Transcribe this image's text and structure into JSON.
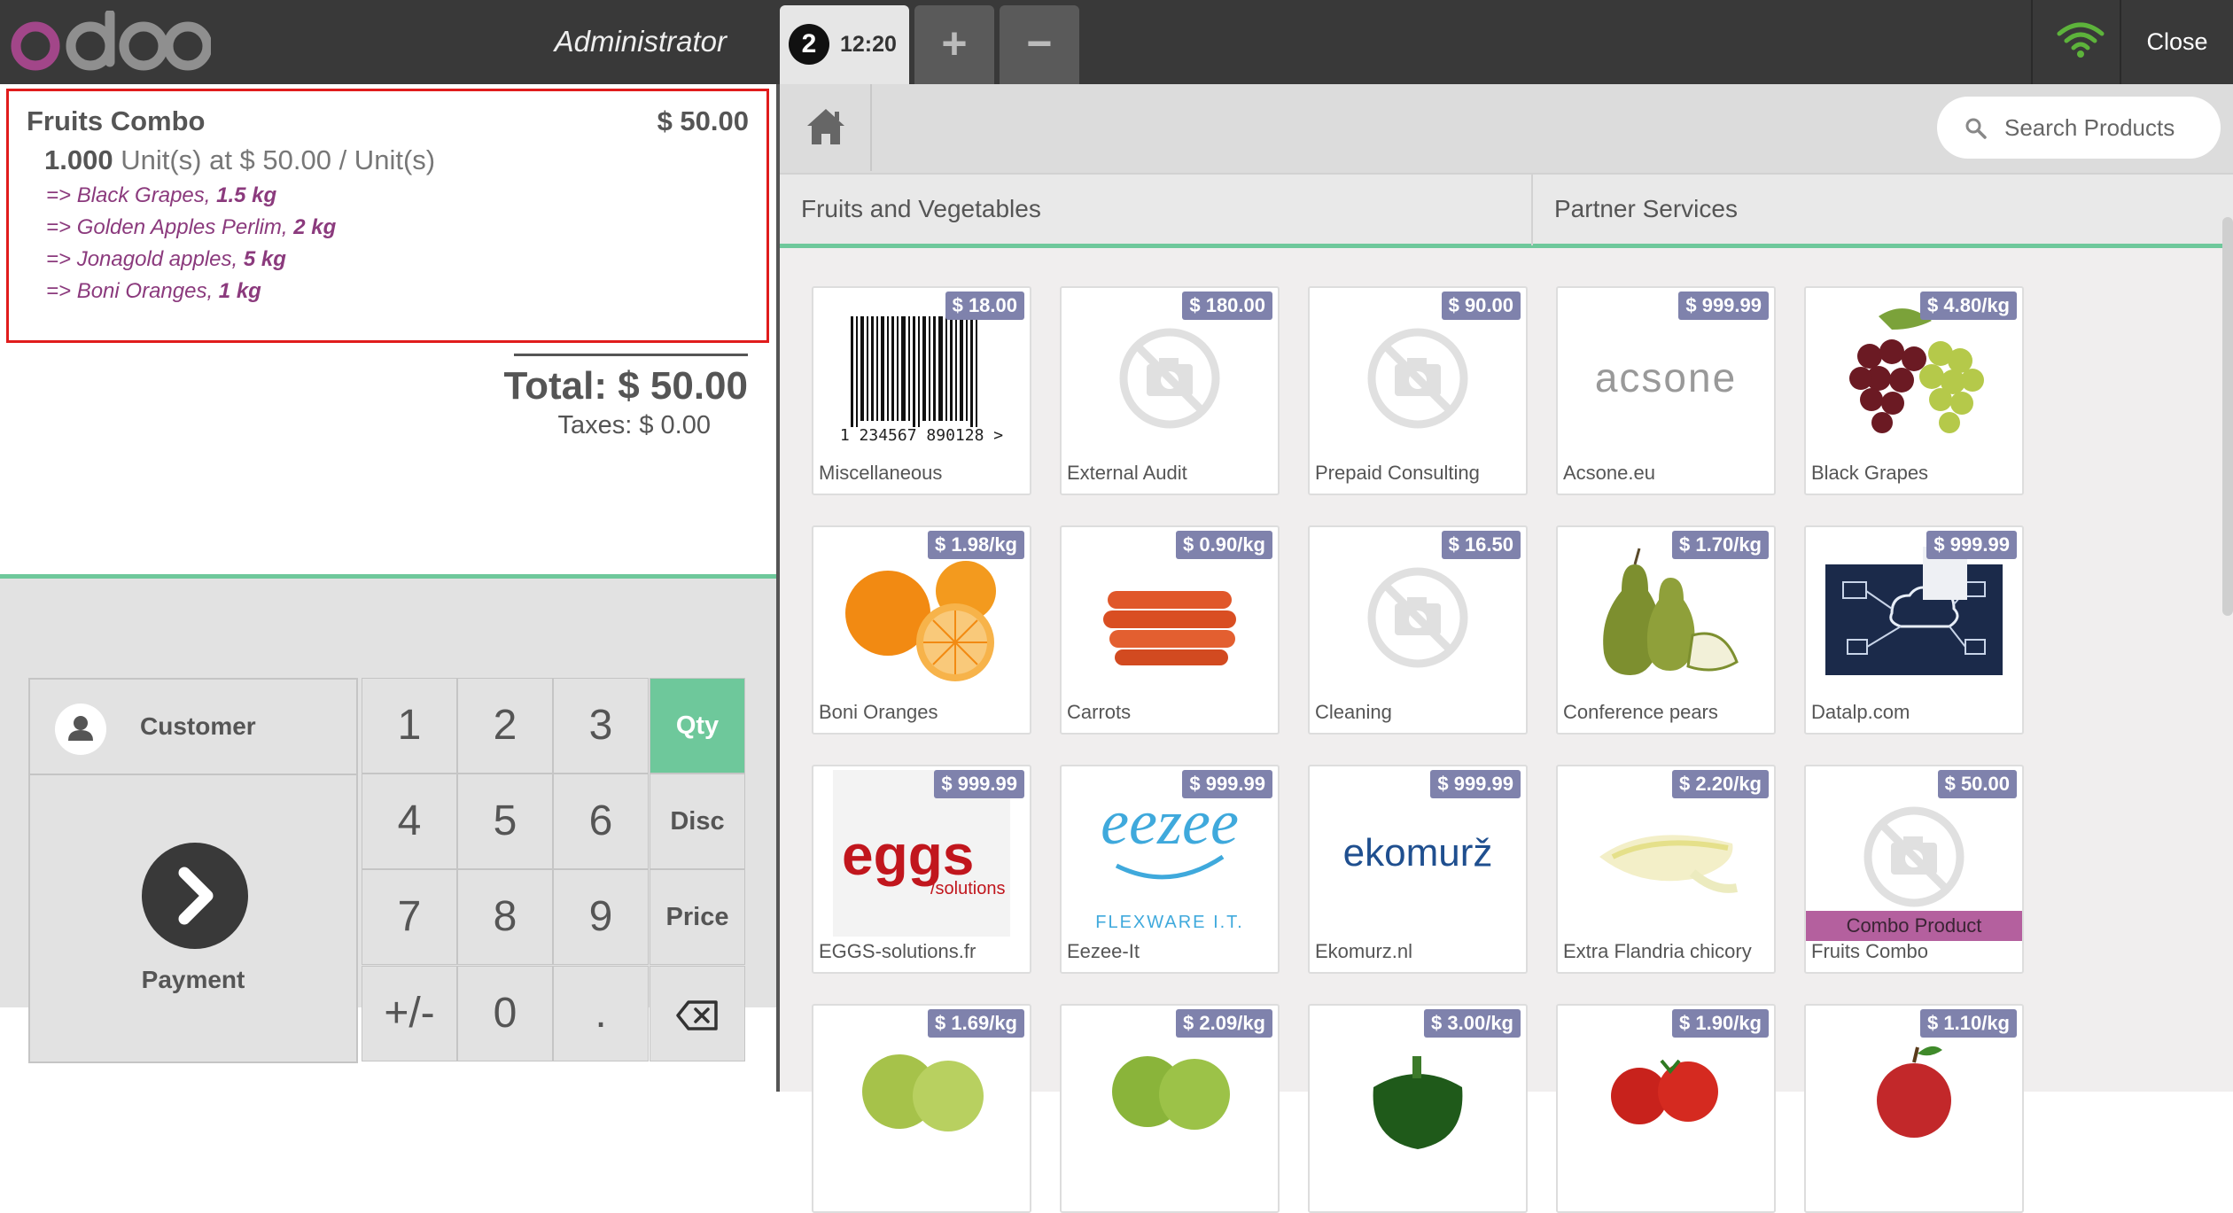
{
  "header": {
    "cashier": "Administrator",
    "order_badge": "2",
    "order_time": "12:20",
    "add_label": "+",
    "remove_label": "−",
    "close_label": "Close"
  },
  "order": {
    "line": {
      "name": "Fruits Combo",
      "price": "$ 50.00",
      "qty": "1.000",
      "unit_info": " Unit(s) at $ 50.00 / Unit(s)"
    },
    "combo_items": [
      {
        "prefix": "=> Black Grapes, ",
        "qty": "1.5 kg"
      },
      {
        "prefix": "=> Golden Apples Perlim, ",
        "qty": "2 kg"
      },
      {
        "prefix": "=> Jonagold apples, ",
        "qty": "5 kg"
      },
      {
        "prefix": "=> Boni Oranges, ",
        "qty": "1 kg"
      }
    ],
    "total": "Total: $ 50.00",
    "taxes": "Taxes: $ 0.00"
  },
  "pad": {
    "customer_label": "Customer",
    "payment_label": "Payment",
    "keys": [
      "1",
      "2",
      "3",
      "4",
      "5",
      "6",
      "7",
      "8",
      "9",
      "+/-",
      "0",
      "."
    ],
    "modes": [
      "Qty",
      "Disc",
      "Price"
    ],
    "active_mode": "Qty",
    "accent_color": "#6ec89b"
  },
  "products_panel": {
    "search_placeholder": "Search Products",
    "categories": [
      "Fruits and Vegetables",
      "Partner Services"
    ],
    "products": [
      {
        "name": "Miscellaneous",
        "price": "$ 18.00",
        "image": "barcode"
      },
      {
        "name": "External Audit",
        "price": "$ 180.00",
        "image": "no-photo"
      },
      {
        "name": "Prepaid Consulting",
        "price": "$ 90.00",
        "image": "no-photo"
      },
      {
        "name": "Acsone.eu",
        "price": "$ 999.99",
        "image": "acsone-logo"
      },
      {
        "name": "Black Grapes",
        "price": "$ 4.80/kg",
        "image": "grapes"
      },
      {
        "name": "Boni Oranges",
        "price": "$ 1.98/kg",
        "image": "oranges"
      },
      {
        "name": "Carrots",
        "price": "$ 0.90/kg",
        "image": "carrots"
      },
      {
        "name": "Cleaning",
        "price": "$ 16.50",
        "image": "no-photo"
      },
      {
        "name": "Conference pears",
        "price": "$ 1.70/kg",
        "image": "pears"
      },
      {
        "name": "Datalp.com",
        "price": "$ 999.99",
        "image": "datalp"
      },
      {
        "name": "EGGS-solutions.fr",
        "price": "$ 999.99",
        "image": "eggs-logo"
      },
      {
        "name": "Eezee-It",
        "price": "$ 999.99",
        "image": "eezee-logo"
      },
      {
        "name": "Ekomurz.nl",
        "price": "$ 999.99",
        "image": "ekomurz-logo"
      },
      {
        "name": "Extra Flandria chicory",
        "price": "$ 2.20/kg",
        "image": "chicory"
      },
      {
        "name": "Fruits Combo",
        "price": "$ 50.00",
        "image": "no-photo",
        "badge": "Combo Product"
      },
      {
        "name": "",
        "price": "$ 1.69/kg",
        "image": "green-apple"
      },
      {
        "name": "",
        "price": "$ 2.09/kg",
        "image": "green-apple"
      },
      {
        "name": "",
        "price": "$ 3.00/kg",
        "image": "pepper"
      },
      {
        "name": "",
        "price": "$ 1.90/kg",
        "image": "tomatoes"
      },
      {
        "name": "",
        "price": "$ 1.10/kg",
        "image": "red-apple"
      }
    ],
    "logo_texts": {
      "barcode_number": "1 234567 890128 >",
      "acsone": "acsone",
      "eggs": "eggs",
      "eggs_sub": "/solutions",
      "eezee": "eezee",
      "eezee_sub": "FLEXWARE I.T.",
      "ekomurz": "ekomurž"
    }
  }
}
